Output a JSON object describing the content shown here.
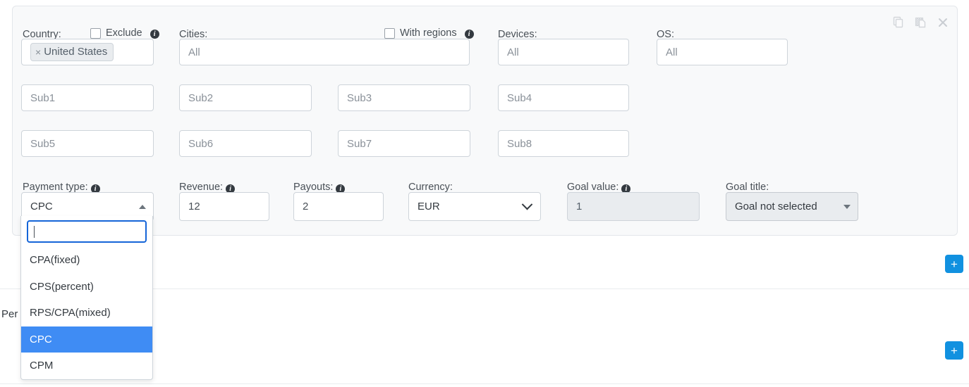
{
  "panel": {
    "window_icons": [
      {
        "name": "copy-icon",
        "title": "Copy"
      },
      {
        "name": "paste-icon",
        "title": "Paste"
      },
      {
        "name": "close-icon",
        "title": "Close",
        "glyph": "×"
      }
    ],
    "row1": {
      "country": {
        "label": "Country:",
        "exclude_label": "Exclude",
        "exclude_checked": false,
        "tags": [
          {
            "text": "United States",
            "remove": "×"
          }
        ]
      },
      "cities": {
        "label": "Cities:",
        "with_regions_label": "With regions",
        "with_regions_checked": false,
        "value": "All"
      },
      "devices": {
        "label": "Devices:",
        "value": "All"
      },
      "os": {
        "label": "OS:",
        "value": "All"
      }
    },
    "subs": [
      {
        "placeholder": "Sub1"
      },
      {
        "placeholder": "Sub2"
      },
      {
        "placeholder": "Sub3"
      },
      {
        "placeholder": "Sub4"
      },
      {
        "placeholder": "Sub5"
      },
      {
        "placeholder": "Sub6"
      },
      {
        "placeholder": "Sub7"
      },
      {
        "placeholder": "Sub8"
      }
    ],
    "row4": {
      "payment_type": {
        "label": "Payment type:",
        "value": "CPC",
        "open": true,
        "search_value": "",
        "options": [
          "CPA(fixed)",
          "CPS(percent)",
          "RPS/CPA(mixed)",
          "CPC",
          "CPM"
        ],
        "selected_option": "CPC"
      },
      "revenue": {
        "label": "Revenue:",
        "value": "12"
      },
      "payouts": {
        "label": "Payouts:",
        "value": "2"
      },
      "currency": {
        "label": "Currency:",
        "value": "EUR"
      },
      "goal_value": {
        "label": "Goal value:",
        "value": "1",
        "disabled": true
      },
      "goal_title": {
        "label": "Goal title:",
        "value": "Goal not selected"
      }
    }
  },
  "below": {
    "section1": {
      "add_label": "+"
    },
    "section2": {
      "text": "Per",
      "add_label": "+"
    }
  },
  "colors": {
    "accent": "#1191e0",
    "selected": "#3f8cf4",
    "focus": "#1565d8",
    "panel_bg": "#f8f9fa",
    "border": "#ced4da"
  }
}
